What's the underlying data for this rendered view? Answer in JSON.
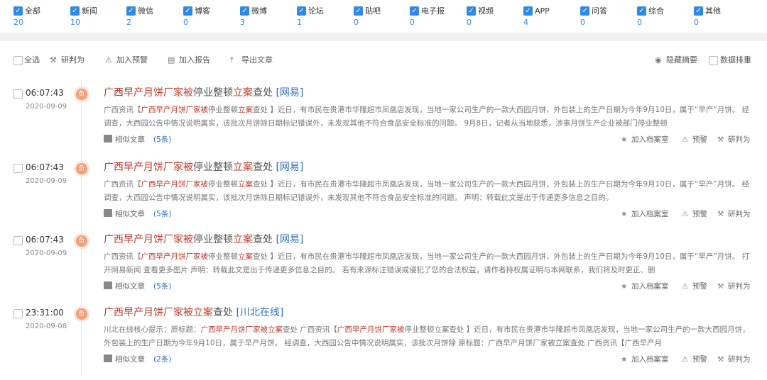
{
  "filters": [
    {
      "label": "全部",
      "count": "20"
    },
    {
      "label": "新闻",
      "count": "10"
    },
    {
      "label": "微信",
      "count": "2"
    },
    {
      "label": "博客",
      "count": "0"
    },
    {
      "label": "微博",
      "count": "3"
    },
    {
      "label": "论坛",
      "count": "1"
    },
    {
      "label": "贴吧",
      "count": "0"
    },
    {
      "label": "电子报",
      "count": "0"
    },
    {
      "label": "视频",
      "count": "0"
    },
    {
      "label": "APP",
      "count": "4"
    },
    {
      "label": "问答",
      "count": "0"
    },
    {
      "label": "综合",
      "count": "0"
    },
    {
      "label": "其他",
      "count": "0"
    }
  ],
  "toolbar": {
    "select_all": "全选",
    "judge": "研判为",
    "add_warning": "加入预警",
    "add_report": "加入报告",
    "export": "导出文章",
    "hide_summary": "隐藏摘要",
    "data_sort": "数据排重"
  },
  "actions": {
    "similar": "相似文章",
    "add_archive": "加入档案室",
    "warning": "预警",
    "judge": "研判为"
  },
  "articles": [
    {
      "time": "06:07:43",
      "date": "2020-09-09",
      "badge": "负",
      "title_a": "广西早产月饼厂家被",
      "title_b": "停业整顿",
      "title_c": "立案",
      "title_d": "查处",
      "source": "[网易]",
      "body_pre": "广西资讯【",
      "body_kw": "广西早产月饼厂家被",
      "body_mid": "停业整顿",
      "body_kw2": "立案",
      "body_post": "查处 】近日，有市民在贵港市华隆超市凤凰店发现，当地一家公司生产的一款大西园月饼，外包装上的生产日期为今年9月10日，属于“早产”月饼。 经调查，大西园公告中情况说明属实，该批次月饼除日期标记错误外，未发现其他不符合食品安全标准的问题。 9月8日，记者从当地获悉，涉事月饼生产企业被部门停业整顿",
      "similar_count": "(5条)"
    },
    {
      "time": "06:07:43",
      "date": "2020-09-09",
      "badge": "负",
      "title_a": "广西早产月饼厂家被",
      "title_b": "停业整顿",
      "title_c": "立案",
      "title_d": "查处",
      "source": "[网易]",
      "body_pre": "广西资讯【",
      "body_kw": "广西早产月饼厂家被",
      "body_mid": "停业整顿",
      "body_kw2": "立案",
      "body_post": "查处 】近日，有市民在贵港市华隆超市凤凰店发现，当地一家公司生产的一款大西园月饼，外包装上的生产日期为今年9月10日，属于“早产”月饼。 经调查，大西园公告中情况说明属实，该批次月饼除日期标记错误外，未发现其他不符合食品安全标准的问题。 声明：转载此文是出于传递更多信息之目的。",
      "similar_count": "(5条)"
    },
    {
      "time": "06:07:43",
      "date": "2020-09-09",
      "badge": "负",
      "title_a": "广西早产月饼厂家被",
      "title_b": "停业整顿",
      "title_c": "立案",
      "title_d": "查处",
      "source": "[网易]",
      "body_pre": "广西资讯【",
      "body_kw": "广西早产月饼厂家被",
      "body_mid": "停业整顿",
      "body_kw2": "立案",
      "body_post": "查处 】近日，有市民在贵港市华隆超市凤凰店发现，当地一家公司生产的一款大西园月饼，外包装上的生产日期为今年9月10日，属于“早产”月饼。 打开网易新闻 查看更多图片 声明：转载此文是出于传递更多信息之目的。 若有来源标注错误或侵犯了您的合法权益，请作者持权属证明与本网联系，我们将及时更正、删",
      "similar_count": "(5条)"
    },
    {
      "time": "23:31:00",
      "date": "2020-09-08",
      "badge": "负",
      "title_a": "广西早产月饼厂家被",
      "title_b": "",
      "title_c": "立案",
      "title_d": "查处",
      "source": "[川北在线]",
      "body_pre": "川北在线核心提示：原标题：",
      "body_kw": "广西早产月饼厂家被立案",
      "body_mid": "查处 广西资讯【",
      "body_kw2": "广西早产月饼厂家被",
      "body_post": "停业整顿立案查处 】近日，有市民在贵港市华隆超市凤凰店发现，当地一家公司生产的一款大西园月饼，外包装上的生产日期为今年9月10日，属于早产月饼。 经调查，大西园公告中情况说明属实，该批次月饼除 原标题：广西早产月饼厂家被立案查处 广西资讯【广西早产月",
      "similar_count": "(2条)"
    }
  ]
}
